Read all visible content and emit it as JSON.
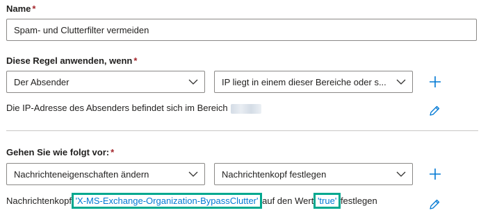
{
  "name_section": {
    "label": "Name",
    "required_mark": "*",
    "value": "Spam- und Clutterfilter vermeiden"
  },
  "condition_section": {
    "label": "Diese Regel anwenden, wenn",
    "required_mark": "*",
    "dropdown1": "Der Absender",
    "dropdown2": "IP liegt in einem dieser Bereiche oder s...",
    "description_text": "Die IP-Adresse des Absenders befindet sich im Bereich"
  },
  "action_section": {
    "label": "Gehen Sie wie folgt vor:",
    "required_mark": "*",
    "dropdown1": "Nachrichteneigenschaften ändern",
    "dropdown2": "Nachrichtenkopf festlegen",
    "desc_prefix": "Nachrichtenkopf",
    "header_name": "'X-MS-Exchange-Organization-BypassClutter'",
    "desc_middle": "auf den Wert",
    "header_value": "'true'",
    "desc_suffix": "festlegen"
  },
  "colors": {
    "accent": "#0078d4",
    "highlight": "#00a88f",
    "required": "#a4262c"
  },
  "icons": [
    "chevron-down-icon",
    "add-icon",
    "edit-pencil-icon"
  ]
}
